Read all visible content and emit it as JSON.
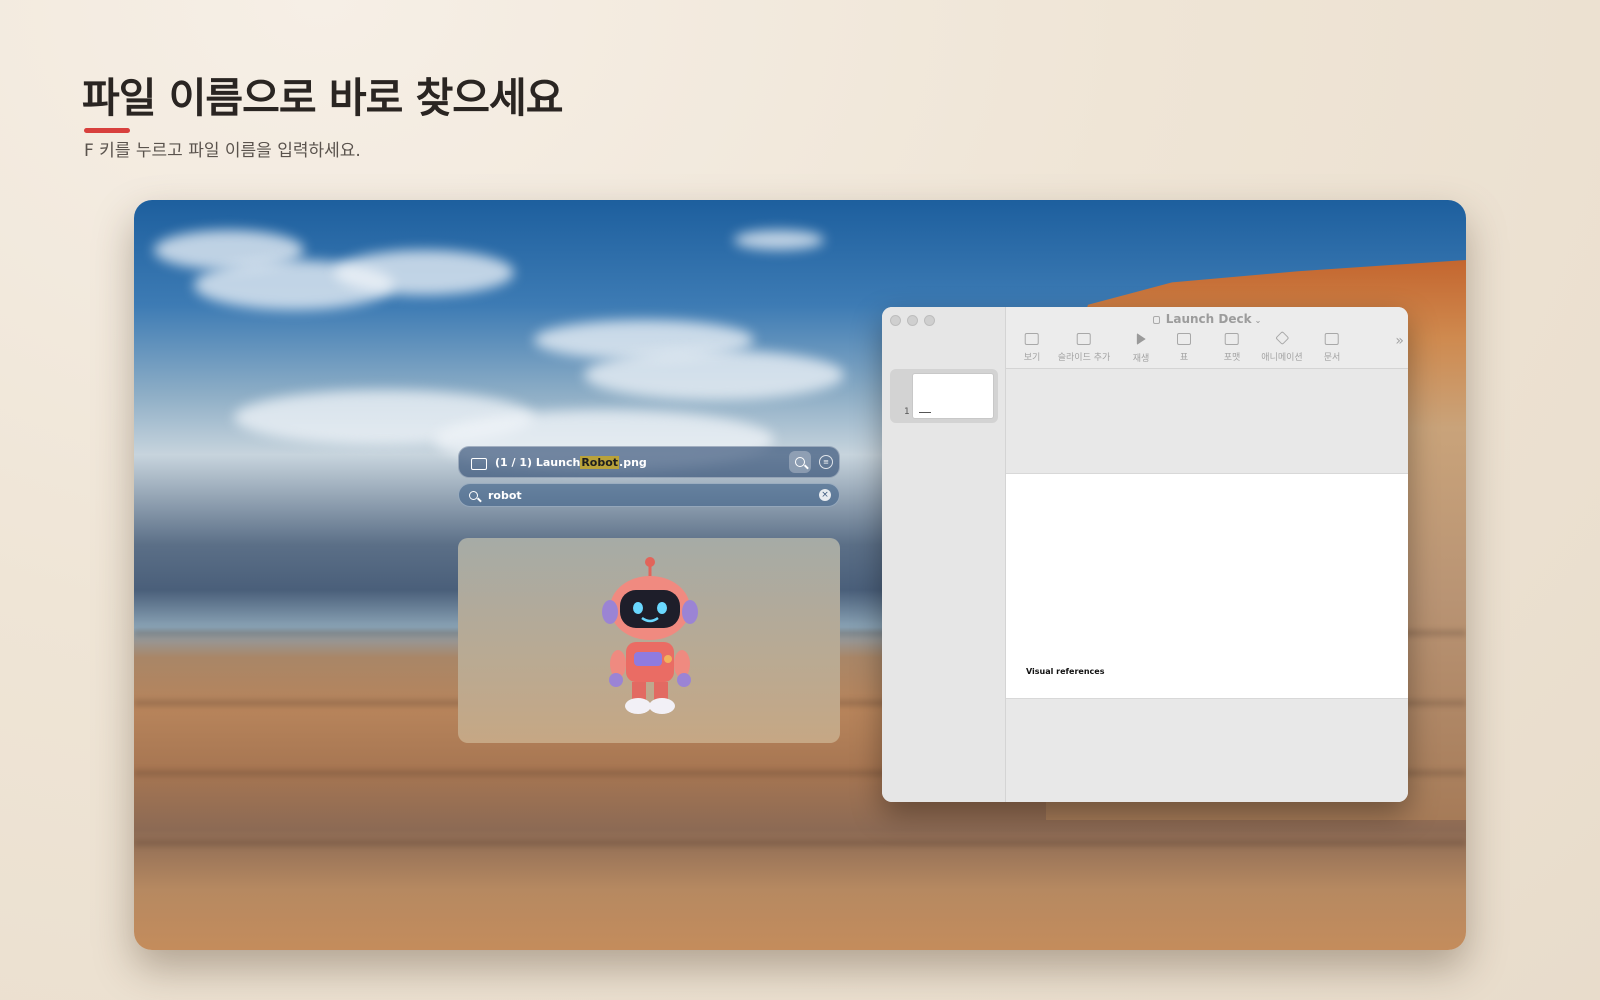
{
  "header": {
    "title": "파일 이름으로 바로 찾으세요",
    "subtitle": "F 키를 누르고 파일 이름을 입력하세요."
  },
  "finder": {
    "result_prefix": "(1 / 1) Launch",
    "result_match": "Robot",
    "result_suffix": ".png",
    "query": "robot",
    "search_icon": "search-icon",
    "filter_icon": "filter-icon",
    "clear_icon": "clear-icon",
    "folder_icon": "folder-icon"
  },
  "app": {
    "doc_title": "Launch Deck",
    "tools": [
      {
        "label": "보기",
        "icon": "sidebar-view-icon"
      },
      {
        "label": "슬라이드 추가",
        "icon": "add-slide-icon"
      },
      {
        "label": "재생",
        "icon": "play-icon"
      },
      {
        "label": "표",
        "icon": "table-icon"
      },
      {
        "label": "포맷",
        "icon": "format-brush-icon"
      },
      {
        "label": "애니메이션",
        "icon": "animate-icon"
      },
      {
        "label": "문서",
        "icon": "document-icon"
      }
    ],
    "more_icon": "chevron-double-right-icon",
    "slide_number": "1",
    "slide_caption": "Visual references"
  },
  "colors": {
    "accent": "#d8403d",
    "highlight": "#b9a23a"
  }
}
